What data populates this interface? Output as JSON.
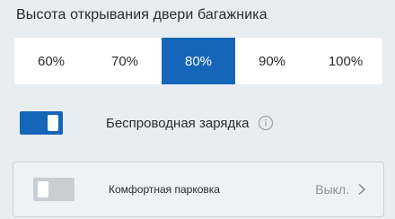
{
  "tailgate": {
    "title": "Высота открывания двери багажника",
    "options": [
      "60%",
      "70%",
      "80%",
      "90%",
      "100%"
    ],
    "selected": "80%"
  },
  "wireless_charging": {
    "label": "Беспроводная зарядка",
    "state": "on",
    "info_icon": "info-circle-icon"
  },
  "comfort_parking": {
    "label": "Комфортная парковка",
    "status": "Выкл.",
    "state": "off",
    "chevron_icon": "chevron-right-icon"
  },
  "colors": {
    "accent": "#1565b8",
    "background": "#e8edf2"
  }
}
